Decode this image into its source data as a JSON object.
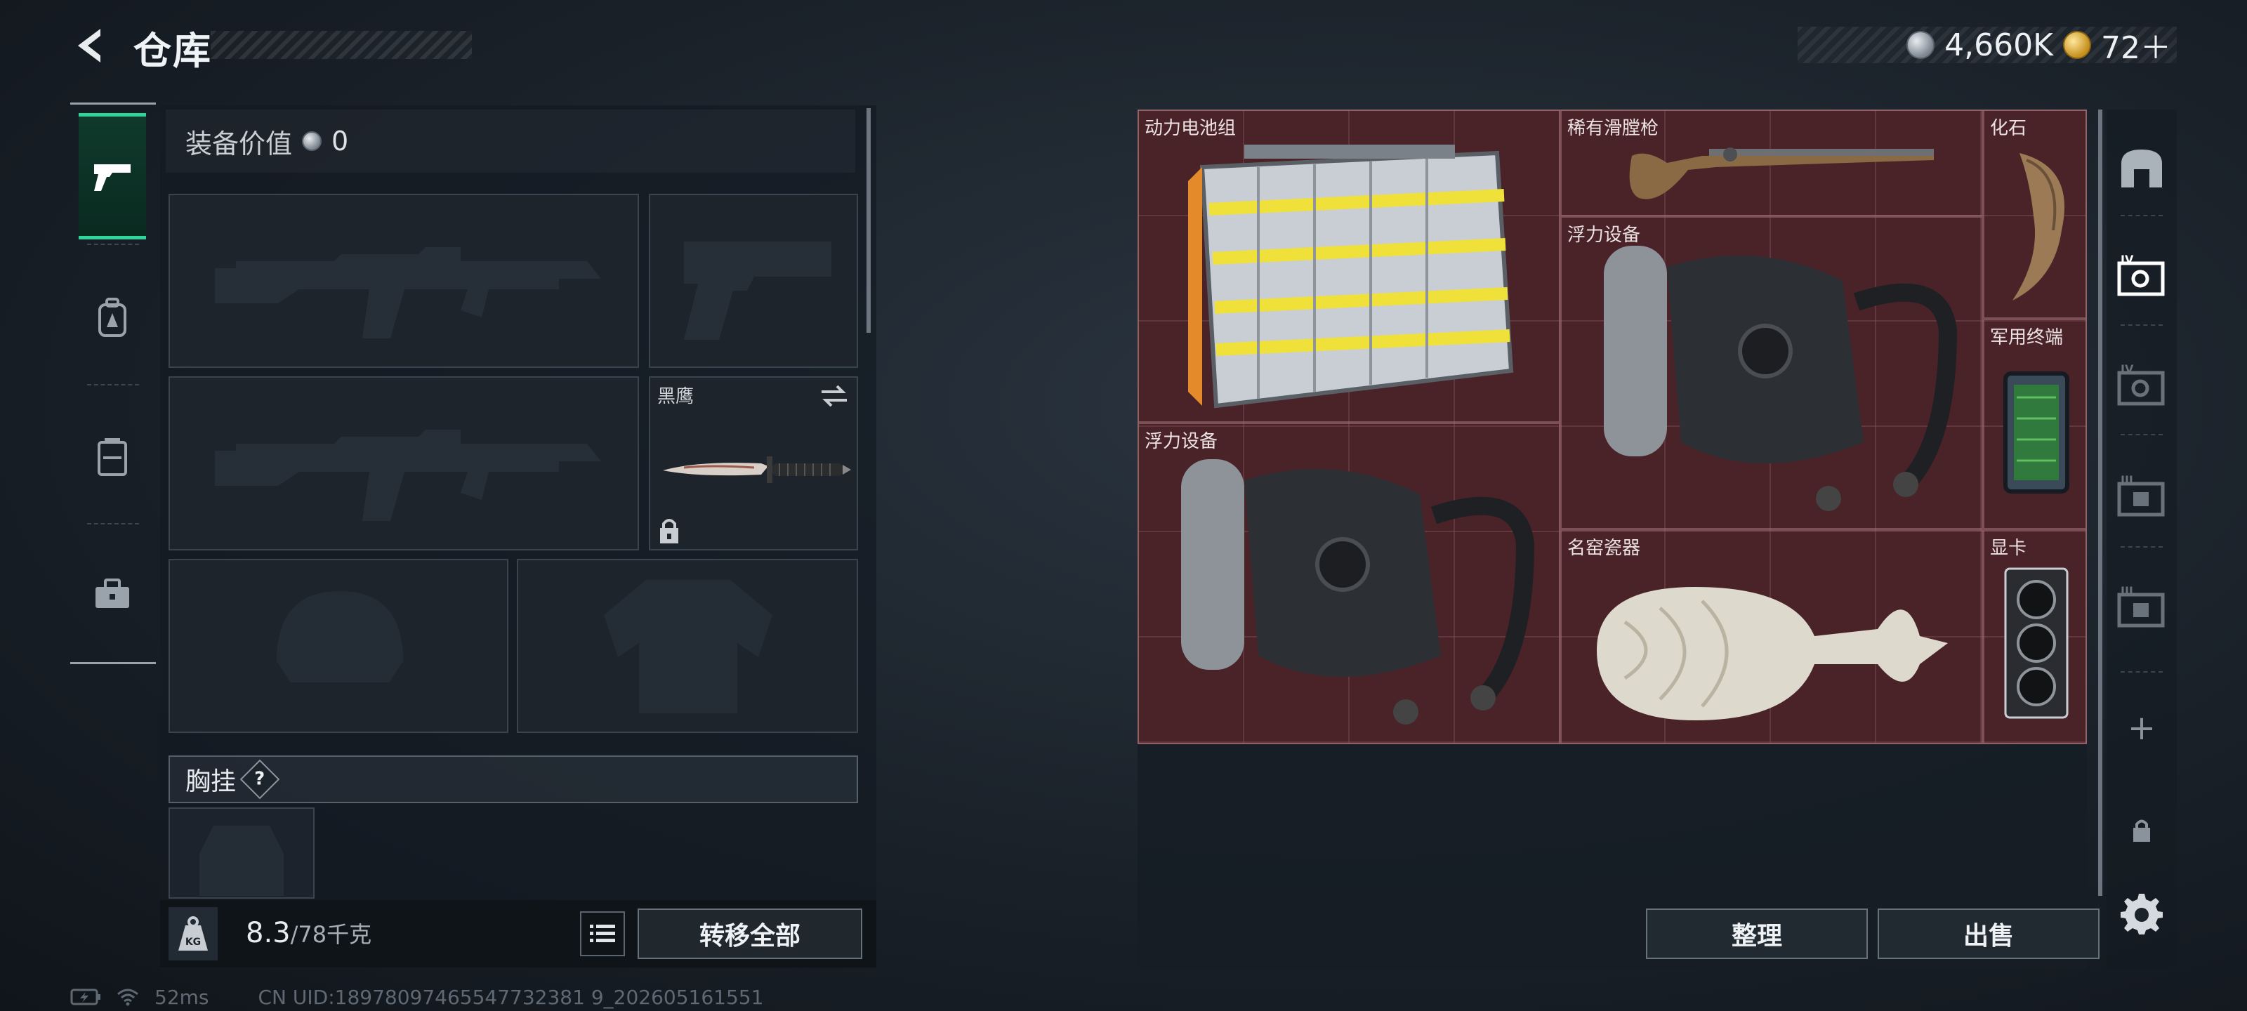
{
  "header": {
    "title": "仓库",
    "currencies": [
      {
        "icon": "silver-coin-icon",
        "value": "4,660K"
      },
      {
        "icon": "gold-coin-icon",
        "value": "72＋"
      }
    ]
  },
  "left_tabs": [
    {
      "icon": "pistol-icon",
      "active": true
    },
    {
      "icon": "backpack-icon",
      "active": false
    },
    {
      "icon": "vest-icon",
      "active": false
    },
    {
      "icon": "toolbox-icon",
      "active": false
    }
  ],
  "loadout": {
    "equip_value_label": "装备价值",
    "equip_value": "0",
    "knife_slot_label": "黑鹰",
    "chest_rig_label": "胸挂",
    "chest_rig_help": "?"
  },
  "weight": {
    "kg_label": "KG",
    "current": "8.3",
    "max": "/78千克"
  },
  "buttons": {
    "transfer_all": "转移全部",
    "sort": "整理",
    "sell": "出售"
  },
  "storage_items": [
    {
      "name": "动力电池组"
    },
    {
      "name": "稀有滑膛枪"
    },
    {
      "name": "化石"
    },
    {
      "name": "浮力设备"
    },
    {
      "name": "军用终端"
    },
    {
      "name": "浮力设备"
    },
    {
      "name": "名窑瓷器"
    },
    {
      "name": "显卡"
    }
  ],
  "right_tabs": [
    {
      "icon": "home-case-icon"
    },
    {
      "icon": "safe-box-iv-active-icon"
    },
    {
      "icon": "safe-box-iv-icon"
    },
    {
      "icon": "safe-box-iii-icon"
    },
    {
      "icon": "safe-box-iii-icon"
    },
    {
      "icon": "add-icon",
      "symbol": "+"
    },
    {
      "icon": "lock-icon"
    },
    {
      "icon": "settings-gear-icon"
    }
  ],
  "status": {
    "ping": "52ms",
    "uid": "CN UID:18978097465547732381 9_202605161551"
  }
}
